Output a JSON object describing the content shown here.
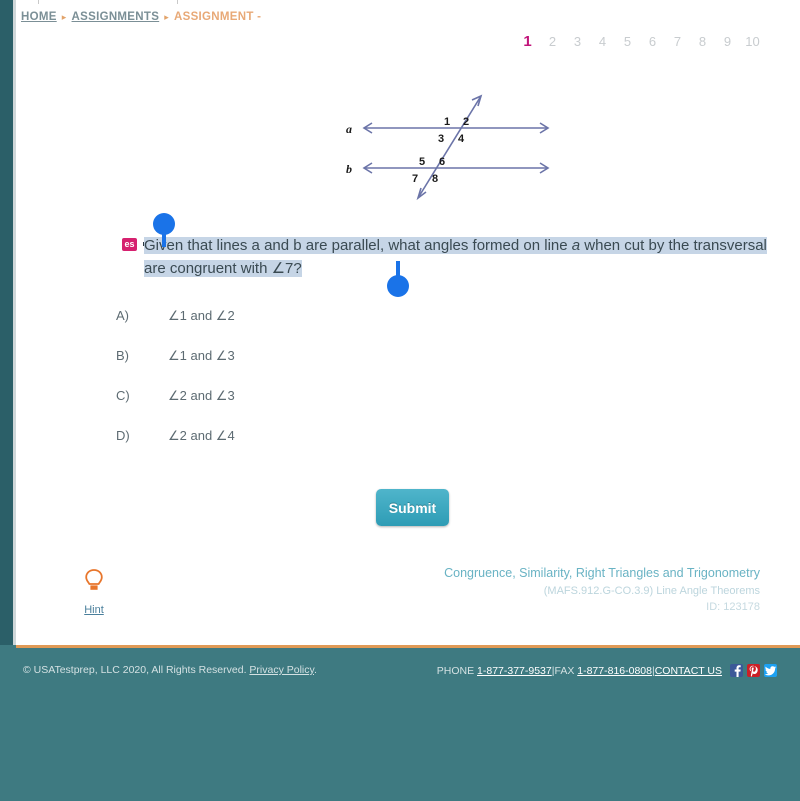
{
  "breadcrumb": {
    "items": [
      {
        "label": "HOME",
        "type": "link"
      },
      {
        "label": "ASSIGNMENTS",
        "type": "link"
      },
      {
        "label": "ASSIGNMENT -",
        "type": "current"
      }
    ],
    "separator": "▸"
  },
  "pagination": {
    "pages": [
      "1",
      "2",
      "3",
      "4",
      "5",
      "6",
      "7",
      "8",
      "9",
      "10"
    ],
    "active": "1",
    "active_color": "#c2157b",
    "inactive_color": "#c8cccf"
  },
  "diagram": {
    "type": "parallel-lines-transversal",
    "line_labels": {
      "top": "a",
      "bottom": "b"
    },
    "angle_labels": [
      "1",
      "2",
      "3",
      "4",
      "5",
      "6",
      "7",
      "8"
    ],
    "line_color": "#6b74a8"
  },
  "question": {
    "translate_badge": "es",
    "speaker_icon": "speaker-icon",
    "text_part1": "Given that lines a and b are parallel, what angles formed on line ",
    "text_italic": "a",
    "text_part2": " when cut by the transversal are congruent with ∠7?",
    "selection_color": "#c6d5e6",
    "handle_color": "#1a73e8"
  },
  "answers": [
    {
      "letter": "A)",
      "choice": "∠1 and ∠2"
    },
    {
      "letter": "B)",
      "choice": "∠1 and ∠3"
    },
    {
      "letter": "C)",
      "choice": "∠2 and ∠3"
    },
    {
      "letter": "D)",
      "choice": "∠2 and ∠4"
    }
  ],
  "submit": {
    "label": "Submit",
    "color": "#2e9cb5"
  },
  "hint": {
    "label": "Hint",
    "icon": "lightbulb-icon",
    "icon_color": "#e8762c"
  },
  "standards": {
    "title": "Congruence, Similarity, Right Triangles and Trigonometry",
    "code": "(MAFS.912.G-CO.3.9) Line Angle Theorems",
    "id": "ID: 123178"
  },
  "footer": {
    "copyright": "© USATestprep, LLC 2020, All Rights Reserved.",
    "privacy_label": "Privacy Policy",
    "privacy_suffix": ".",
    "phone_label": "PHONE",
    "phone_number": "1-877-377-9537",
    "sep1": " | ",
    "fax_label": "FAX",
    "fax_number": "1-877-816-0808",
    "sep2": " | ",
    "contact_label": "CONTACT US",
    "social": [
      {
        "name": "facebook-icon",
        "glyph": "f",
        "color": "#3b5998"
      },
      {
        "name": "pinterest-icon",
        "glyph": "P",
        "color": "#cb2027"
      },
      {
        "name": "twitter-icon",
        "glyph": "t",
        "color": "#1da1f2"
      }
    ],
    "background": "#3e7a81"
  }
}
